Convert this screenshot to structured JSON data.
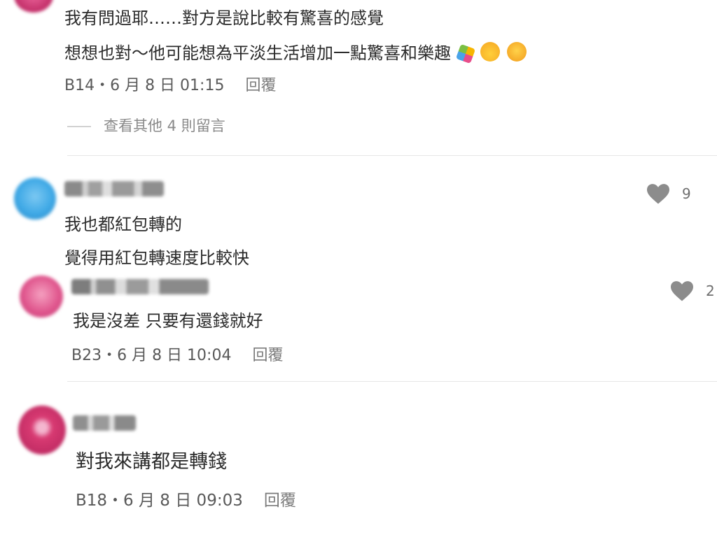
{
  "comments": [
    {
      "lines": [
        "我有問過耶……對方是說比較有驚喜的感覺",
        "想想也對～他可能想為平淡生活增加一點驚喜和樂趣"
      ],
      "emojis": [
        "party-popper-icon",
        "partying-face-icon",
        "grinning-face-icon"
      ],
      "meta": "B14・6 月 8 日 01:15",
      "reply_label": "回覆",
      "more_replies": "查看其他 4 則留言"
    },
    {
      "lines": [
        "我也都紅包轉的",
        "覺得用紅包轉速度比較快"
      ],
      "likes": "9"
    },
    {
      "lines": [
        "我是沒差 只要有還錢就好"
      ],
      "meta": "B23・6 月 8 日 10:04",
      "reply_label": "回覆",
      "likes": "2"
    },
    {
      "lines": [
        "對我來講都是轉錢"
      ],
      "meta": "B18・6 月 8 日 09:03",
      "reply_label": "回覆"
    }
  ],
  "colors": {
    "avatar_blue": "#3fa9e6",
    "avatar_pink": "#e0578e",
    "avatar_magenta": "#d83a72",
    "like_gray": "#8c8c8c"
  }
}
